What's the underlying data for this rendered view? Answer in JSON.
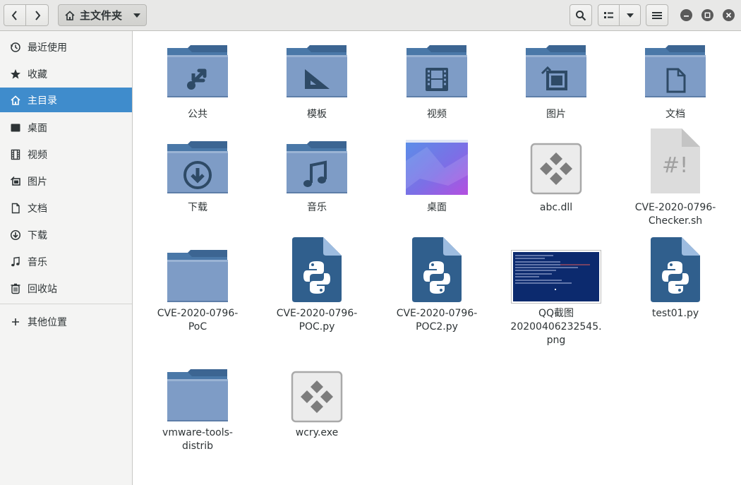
{
  "header": {
    "back_icon": "chevron-left-icon",
    "forward_icon": "chevron-right-icon",
    "path_label": "主文件夹",
    "path_icon": "home-icon"
  },
  "sidebar": {
    "items": [
      {
        "label": "最近使用",
        "icon": "clock-icon"
      },
      {
        "label": "收藏",
        "icon": "star-icon"
      },
      {
        "label": "主目录",
        "icon": "home-icon",
        "active": true
      },
      {
        "label": "桌面",
        "icon": "desktop-icon"
      },
      {
        "label": "视频",
        "icon": "film-icon"
      },
      {
        "label": "图片",
        "icon": "picture-icon"
      },
      {
        "label": "文档",
        "icon": "document-icon"
      },
      {
        "label": "下载",
        "icon": "download-icon"
      },
      {
        "label": "音乐",
        "icon": "music-icon"
      },
      {
        "label": "回收站",
        "icon": "trash-icon"
      }
    ],
    "other_locations": "其他位置"
  },
  "files": [
    {
      "name": "公共",
      "type": "folder",
      "emblem": "share"
    },
    {
      "name": "模板",
      "type": "folder",
      "emblem": "template"
    },
    {
      "name": "视频",
      "type": "folder",
      "emblem": "film"
    },
    {
      "name": "图片",
      "type": "folder",
      "emblem": "picture"
    },
    {
      "name": "文档",
      "type": "folder",
      "emblem": "document"
    },
    {
      "name": "下载",
      "type": "folder",
      "emblem": "download"
    },
    {
      "name": "音乐",
      "type": "folder",
      "emblem": "music"
    },
    {
      "name": "桌面",
      "type": "desktop-thumb"
    },
    {
      "name": "abc.dll",
      "type": "executable"
    },
    {
      "name": "CVE-2020-0796-\nChecker.sh",
      "type": "script"
    },
    {
      "name": "CVE-2020-0796-\nPoC",
      "type": "folder",
      "emblem": ""
    },
    {
      "name": "CVE-2020-0796-\nPOC.py",
      "type": "python"
    },
    {
      "name": "CVE-2020-0796-\nPOC2.py",
      "type": "python"
    },
    {
      "name": "QQ截图\n20200406232545.\npng",
      "type": "png-thumb"
    },
    {
      "name": "test01.py",
      "type": "python"
    },
    {
      "name": "vmware-tools-\ndistrib",
      "type": "folder",
      "emblem": ""
    },
    {
      "name": "wcry.exe",
      "type": "executable"
    }
  ],
  "colors": {
    "accent": "#3f8ccc",
    "folder": "#7e9cc6",
    "folder_tab": "#3c6592",
    "python_doc": "#305f8d"
  }
}
